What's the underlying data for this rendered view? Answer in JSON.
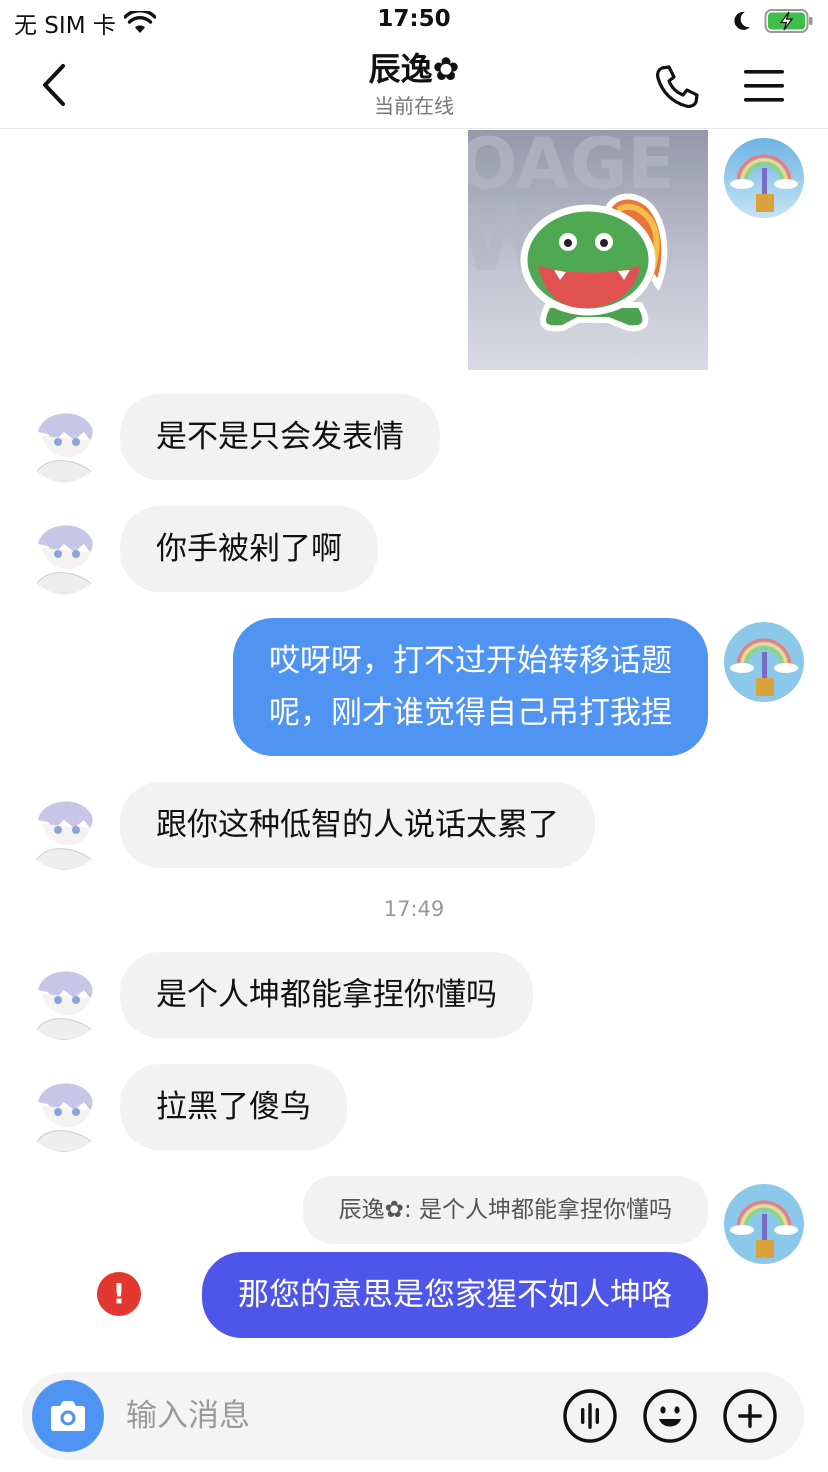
{
  "status_bar": {
    "carrier": "无 SIM 卡",
    "time": "17:50"
  },
  "nav": {
    "title": "辰逸✿",
    "subtitle": "当前在线"
  },
  "messages": [
    {
      "side": "me",
      "type": "sticker",
      "icon": "dinosaur-sticker"
    },
    {
      "side": "other",
      "text": "是不是只会发表情"
    },
    {
      "side": "other",
      "text": "你手被剁了啊"
    },
    {
      "side": "me",
      "lines": [
        "哎呀呀，打不过开始转移话题",
        "呢，刚才谁觉得自己吊打我捏"
      ]
    },
    {
      "side": "other",
      "text": "跟你这种低智的人说话太累了"
    },
    {
      "timestamp": "17:49"
    },
    {
      "side": "other",
      "text": "是个人坤都能拿捏你懂吗"
    },
    {
      "side": "other",
      "text": "拉黑了傻鸟"
    },
    {
      "side": "me",
      "quote": {
        "name": "辰逸✿",
        "text": ": 是个人坤都能拿捏你懂吗"
      },
      "text": "那您的意思是您家猩不如人坤咯",
      "status": "failed",
      "status_icon": "!"
    }
  ],
  "input": {
    "placeholder": "输入消息"
  },
  "colors": {
    "my_bubble": "#4f93f3",
    "my_bubble_last": "#4e56ea",
    "other_bubble": "#f2f2f2",
    "error": "#e3382f"
  }
}
